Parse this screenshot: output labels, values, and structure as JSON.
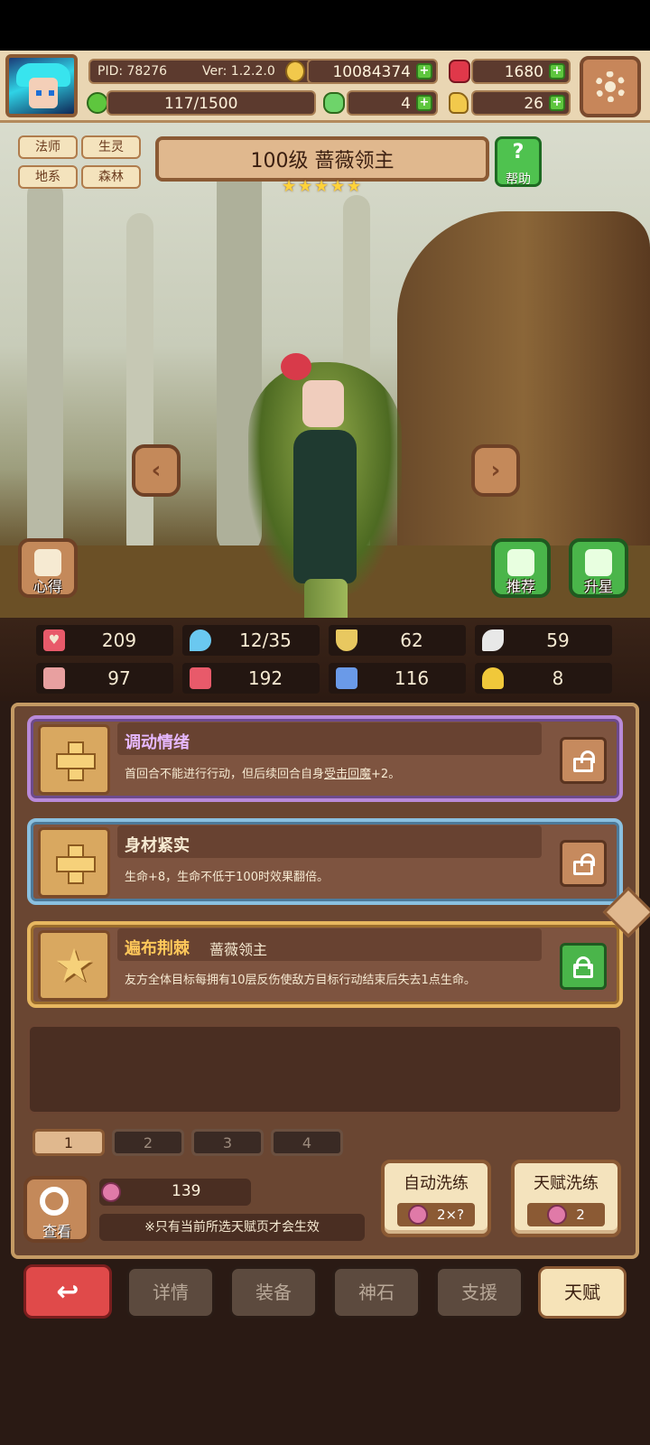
{
  "header": {
    "pid_label": "PID: 78276",
    "version": "Ver: 1.2.2.0",
    "gold": "10084374",
    "gems": "1680",
    "exp": "117/1500",
    "clover": "4",
    "hand": "26"
  },
  "hero": {
    "tags": [
      "法师",
      "生灵",
      "地系",
      "森林"
    ],
    "title": "100级  蔷薇领主",
    "stars": 5,
    "help_label": "帮助",
    "left_button": "心得",
    "recommend_button": "推荐",
    "star_up_button": "升星"
  },
  "stats": [
    {
      "icon": "heart-icon",
      "value": "209",
      "color": "#e85a6a"
    },
    {
      "icon": "water-drop-icon",
      "value": "12/35",
      "color": "#6ac8f0"
    },
    {
      "icon": "shield-icon",
      "value": "62",
      "color": "#e8c860"
    },
    {
      "icon": "wing-icon",
      "value": "59",
      "color": "#e8e8e8"
    },
    {
      "icon": "fist-icon",
      "value": "97",
      "color": "#e8a0a0"
    },
    {
      "icon": "book-icon",
      "value": "192",
      "color": "#e85a6a"
    },
    {
      "icon": "boot-icon",
      "value": "116",
      "color": "#6a9ae8"
    },
    {
      "icon": "horseshoe-icon",
      "value": "8",
      "color": "#f0c83a"
    }
  ],
  "talents": [
    {
      "name": "调动情绪",
      "sub": "",
      "desc_pre": "首回合不能进行行动，但后续回合自身",
      "desc_link": "受击回魔",
      "desc_post": "+2。",
      "rarity": "purple",
      "locked": true
    },
    {
      "name": "身材紧实",
      "sub": "",
      "desc_pre": "生命+8，生命不低于100时效果翻倍。",
      "desc_link": "",
      "desc_post": "",
      "rarity": "blue",
      "locked": true
    },
    {
      "name": "遍布荆棘",
      "sub": "蔷薇领主",
      "desc_pre": "友方全体目标每拥有10层反伤使敌方目标行动结束后失去1点生命。",
      "desc_link": "",
      "desc_post": "",
      "rarity": "gold",
      "locked": false
    }
  ],
  "pages": [
    "1",
    "2",
    "3",
    "4"
  ],
  "bottom": {
    "view_label": "查看",
    "currency_amount": "139",
    "note": "※只有当前所选天赋页才会生效",
    "auto_reroll_label": "自动洗练",
    "auto_reroll_cost": "2×?",
    "talent_reroll_label": "天赋洗练",
    "talent_reroll_cost": "2"
  },
  "nav": [
    "详情",
    "装备",
    "神石",
    "支援",
    "天赋"
  ],
  "colors": {
    "accent_gold": "#e7b760",
    "panel": "#6a4632",
    "purple": "#b98ad9",
    "blue": "#8ac0e0"
  }
}
